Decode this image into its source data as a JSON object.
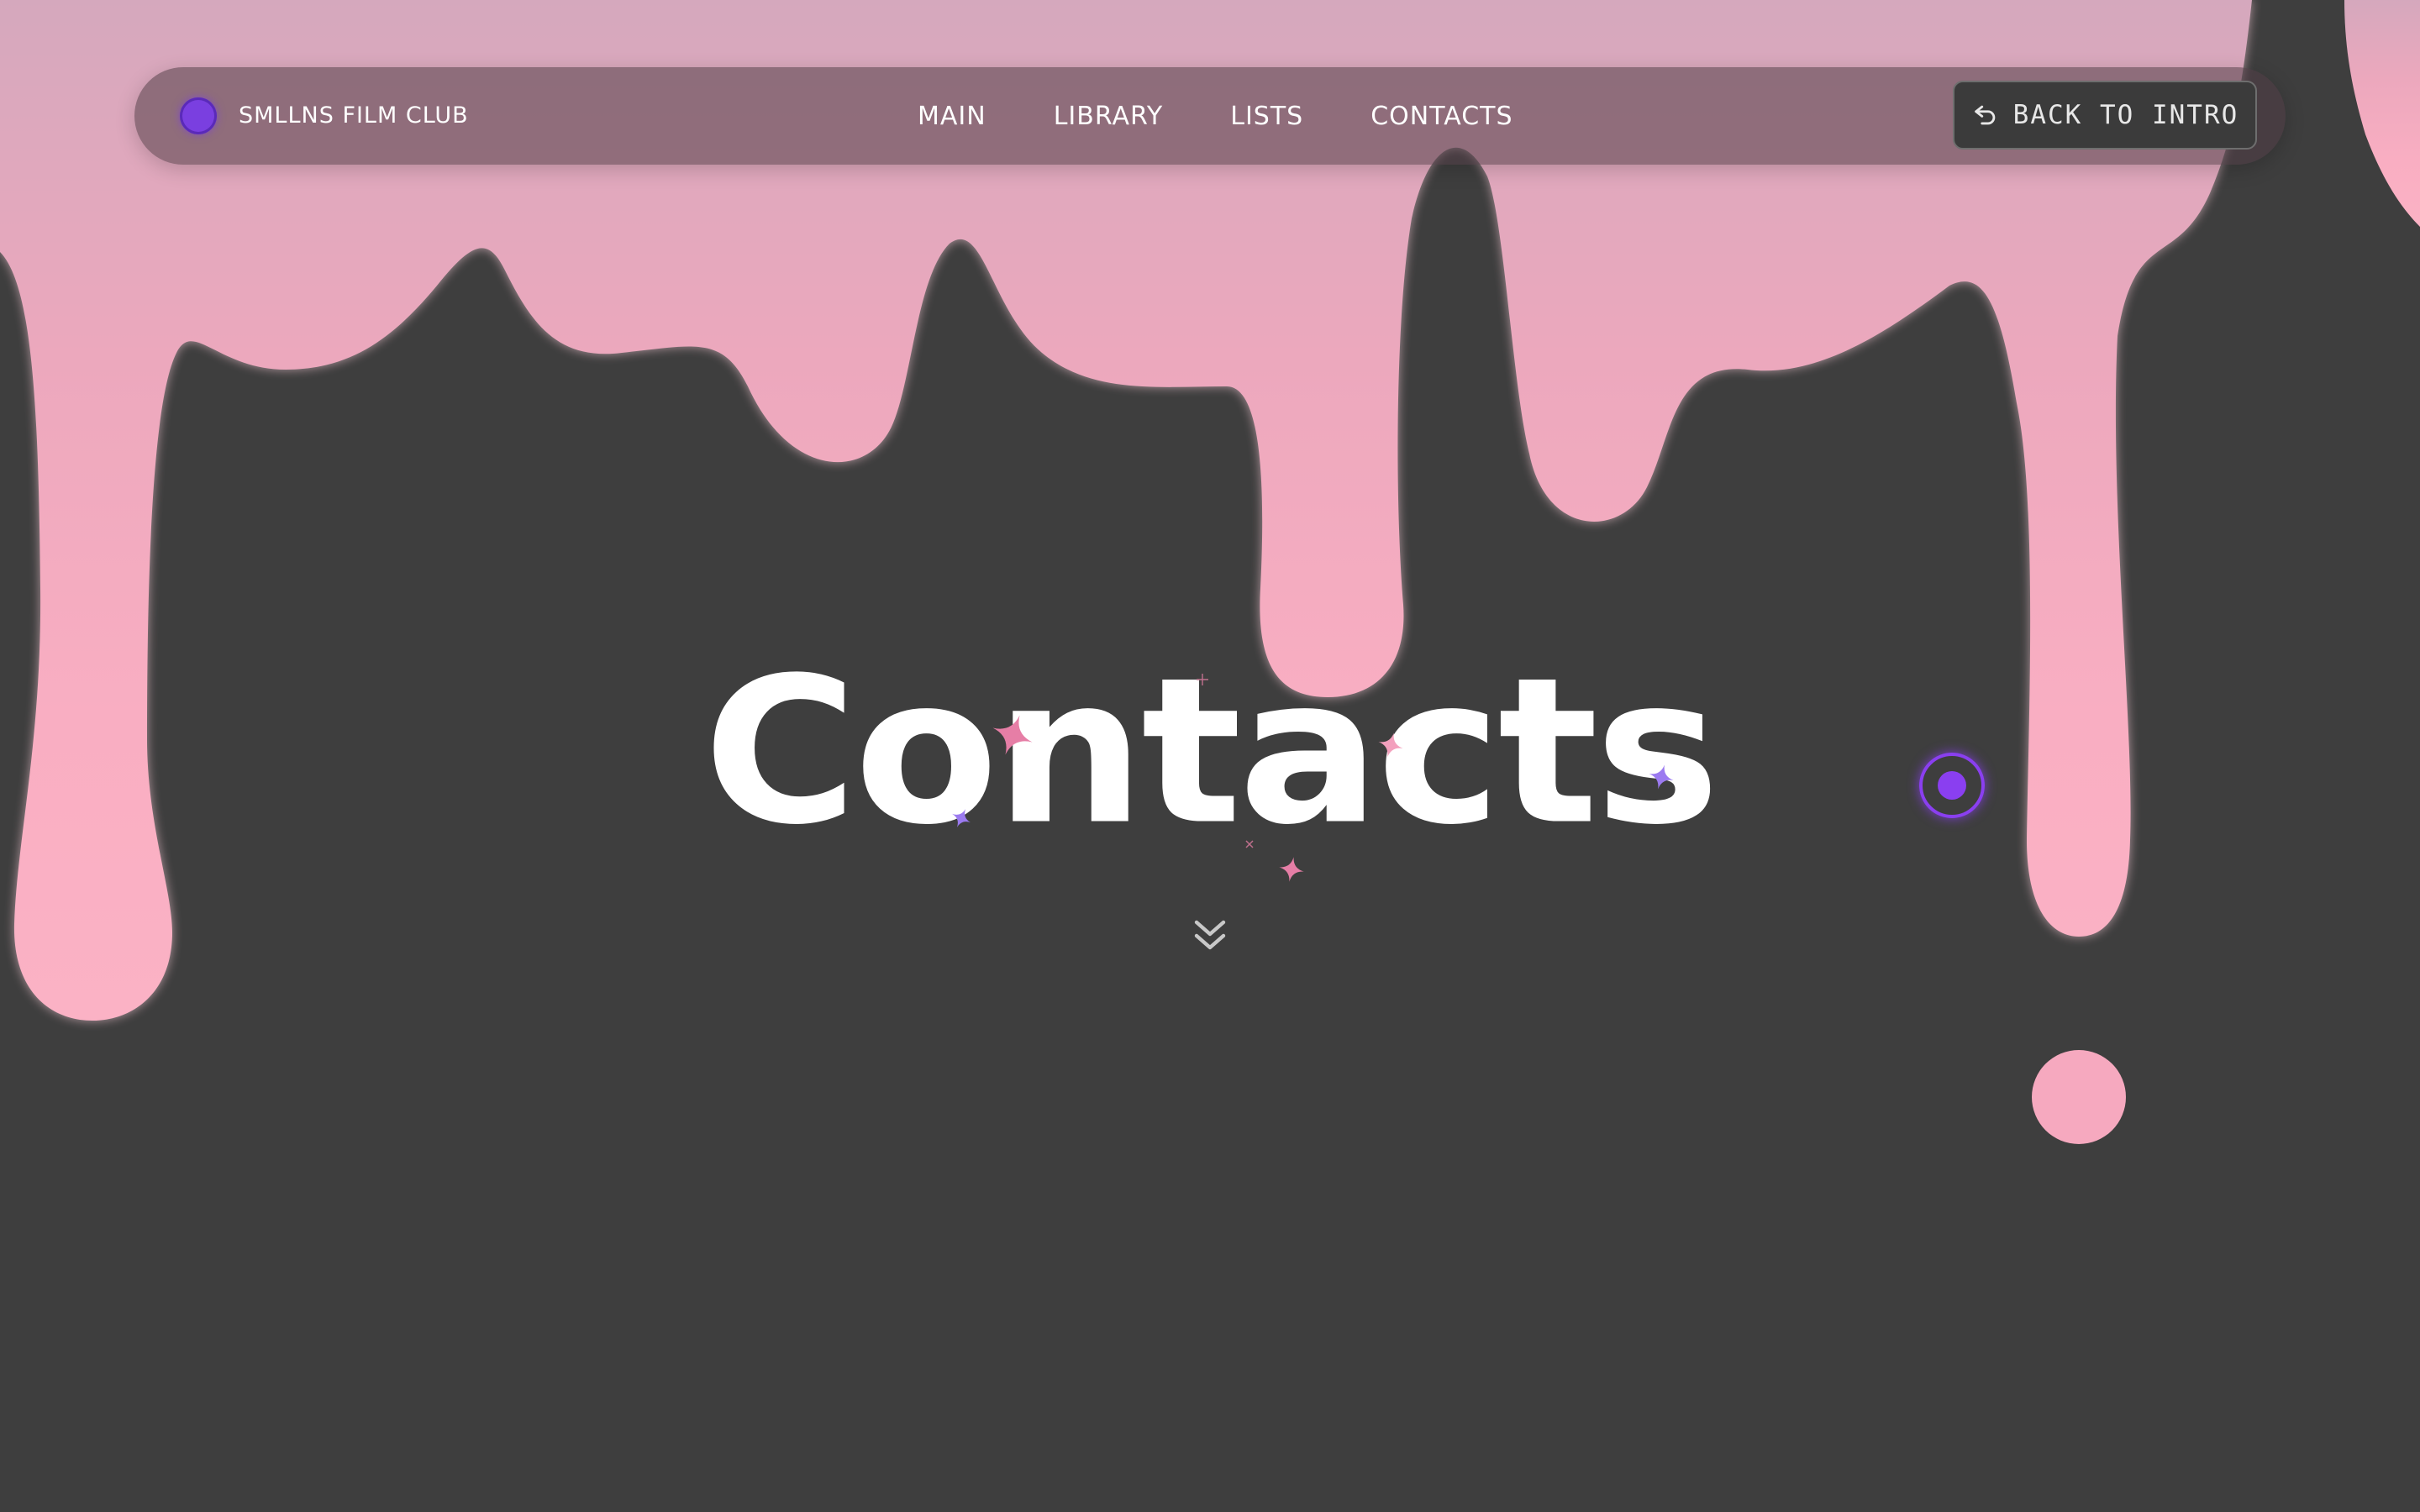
{
  "nav": {
    "brand": "SMLLNS FILM CLUB",
    "links": [
      "MAIN",
      "LIBRARY",
      "LISTS",
      "CONTACTS"
    ],
    "back_label": "BACK TO INTRO"
  },
  "hero": {
    "title": "Contacts"
  },
  "colors": {
    "background": "#3e3e3e",
    "drip_top": "#d8a7bb",
    "drip_bottom": "#f9aec2",
    "accent_purple": "#8a3ff0",
    "text": "#ffffff"
  },
  "icons": {
    "logo": "logo-dot-icon",
    "back": "undo-arrow-icon",
    "scroll": "double-chevron-down-icon",
    "cursor": "cursor-ring-icon"
  }
}
